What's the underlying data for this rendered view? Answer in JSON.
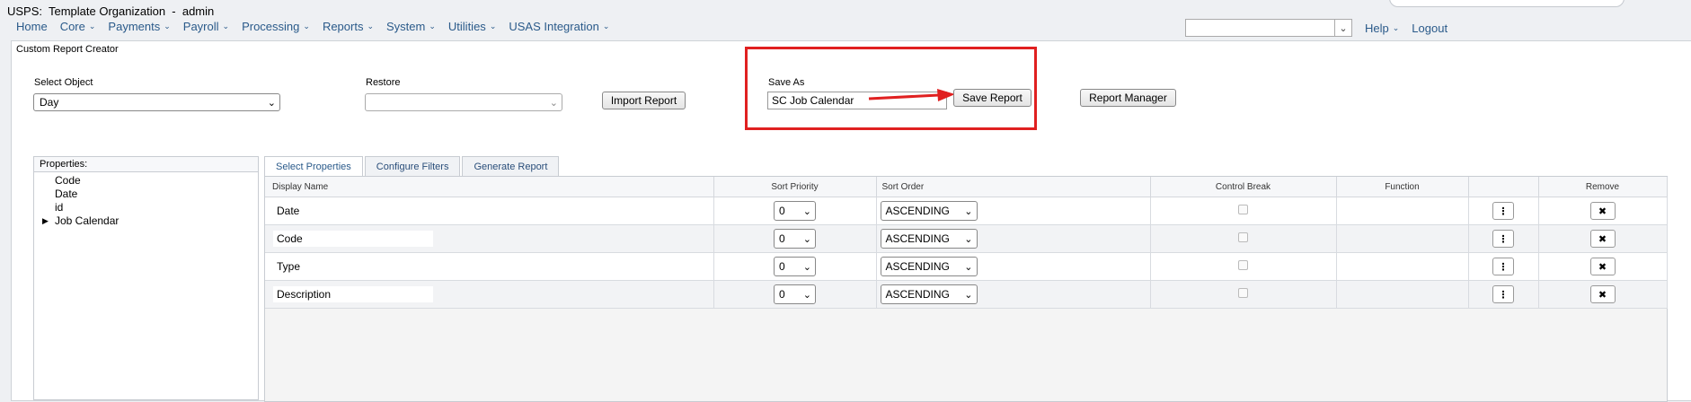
{
  "app": {
    "title": "USPS:  Template Organization  -  admin"
  },
  "nav": {
    "items": [
      {
        "label": "Home",
        "dropdown": false
      },
      {
        "label": "Core",
        "dropdown": true
      },
      {
        "label": "Payments",
        "dropdown": true
      },
      {
        "label": "Payroll",
        "dropdown": true
      },
      {
        "label": "Processing",
        "dropdown": true
      },
      {
        "label": "Reports",
        "dropdown": true
      },
      {
        "label": "System",
        "dropdown": true
      },
      {
        "label": "Utilities",
        "dropdown": true
      },
      {
        "label": "USAS Integration",
        "dropdown": true
      }
    ],
    "help": "Help",
    "logout": "Logout"
  },
  "panel": {
    "title": "Custom Report Creator"
  },
  "form": {
    "select_object_label": "Select Object",
    "select_object_value": "Day",
    "restore_label": "Restore",
    "restore_value": "",
    "import_button": "Import Report",
    "save_as_label": "Save As",
    "save_as_value": "SC Job Calendar",
    "save_button": "Save Report",
    "report_manager_button": "Report Manager"
  },
  "properties": {
    "title": "Properties:",
    "items": [
      "Code",
      "Date",
      "id",
      "Job Calendar"
    ]
  },
  "tabs": [
    "Select Properties",
    "Configure Filters",
    "Generate Report"
  ],
  "grid": {
    "headers": [
      "Display Name",
      "Sort Priority",
      "Sort Order",
      "Control Break",
      "Function",
      "",
      "Remove"
    ],
    "rows": [
      {
        "name": "Date",
        "priority": "0",
        "order": "ASCENDING"
      },
      {
        "name": "Code",
        "priority": "0",
        "order": "ASCENDING"
      },
      {
        "name": "Type",
        "priority": "0",
        "order": "ASCENDING"
      },
      {
        "name": "Description",
        "priority": "0",
        "order": "ASCENDING"
      }
    ]
  },
  "colors": {
    "link": "#2a5a8a",
    "highlight": "#e02020"
  }
}
